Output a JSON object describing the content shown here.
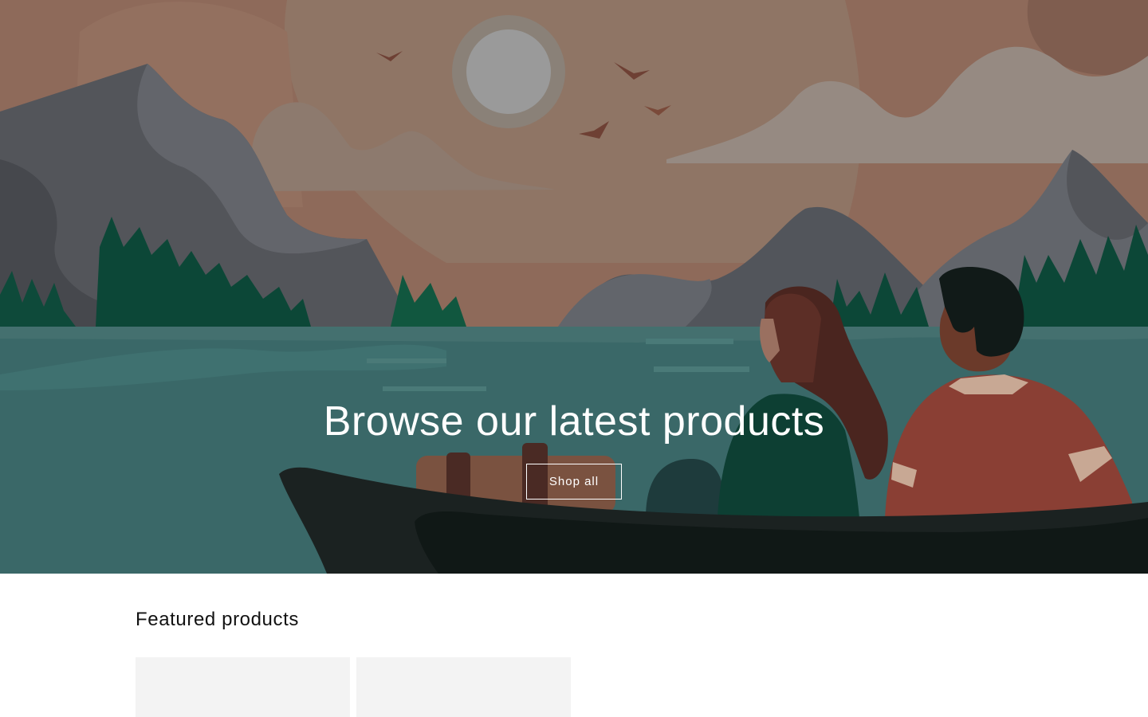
{
  "hero": {
    "title": "Browse our latest products",
    "button_label": "Shop all",
    "image": "illustration-couple-in-canoe-on-lake"
  },
  "featured": {
    "title": "Featured products",
    "products": [
      {
        "image": "placeholder"
      },
      {
        "image": "placeholder"
      }
    ]
  },
  "colors": {
    "sky": "#8e6c5c",
    "sun": "#9a9a9a",
    "water": "#3b6768",
    "trees": "#0e4a3a",
    "boat": "#1b2222",
    "placeholder": "#f3f3f3"
  }
}
